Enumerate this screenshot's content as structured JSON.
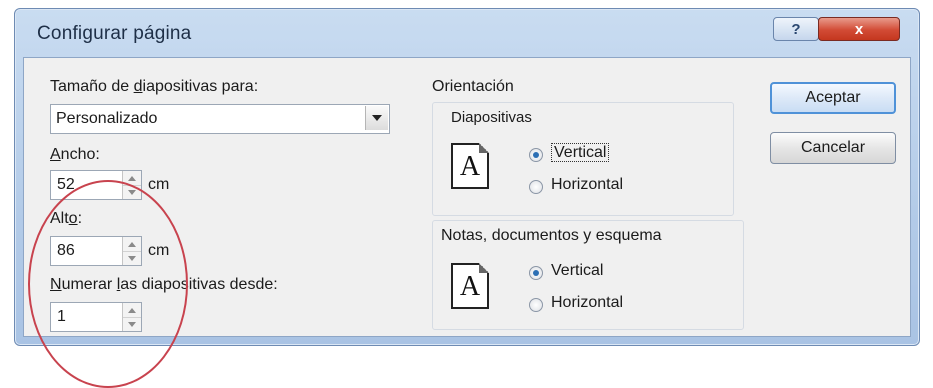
{
  "window": {
    "title": "Configurar página",
    "help_label": "?",
    "close_label": "x"
  },
  "size": {
    "label_prefix": "Tamaño de ",
    "label_accel": "d",
    "label_suffix": "iapositivas para:",
    "selected": "Personalizado"
  },
  "width": {
    "label_accel": "A",
    "label_rest": "ncho:",
    "value": "52",
    "unit": "cm"
  },
  "height": {
    "label_pre": "Alt",
    "label_accel": "o",
    "label_rest": ":",
    "value": "86",
    "unit": "cm"
  },
  "numbering": {
    "label_accel": "N",
    "label_mid": "umerar ",
    "label_accel2": "l",
    "label_rest": "as diapositivas desde:",
    "value": "1"
  },
  "orientation": {
    "heading": "Orientación",
    "slides": {
      "heading": "Diapositivas",
      "icon_letter": "A",
      "option_vertical": "Vertical",
      "option_horizontal": "Horizontal",
      "selected": "Vertical"
    },
    "notes": {
      "heading": "Notas, documentos y esquema",
      "icon_letter": "A",
      "option_vertical": "Vertical",
      "option_horizontal": "Horizontal",
      "selected": "Vertical"
    }
  },
  "buttons": {
    "ok": "Aceptar",
    "cancel": "Cancelar"
  },
  "colors": {
    "annotation": "#c8434e",
    "default_button_border": "#4f92d8",
    "close_button": "#d24b35"
  }
}
